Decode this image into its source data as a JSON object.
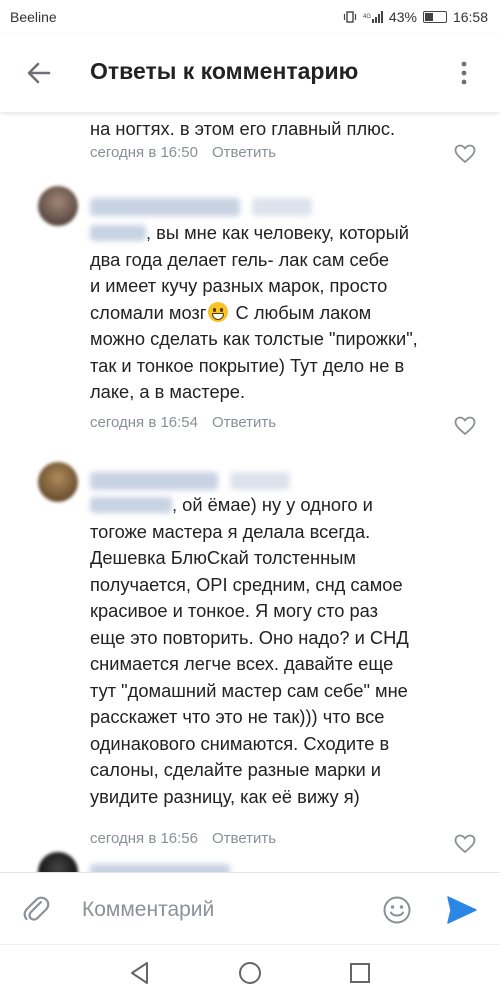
{
  "status_bar": {
    "carrier": "Beeline",
    "icons_text": "",
    "battery_percent": "43%",
    "battery_level": 0.43,
    "time": "16:58"
  },
  "header": {
    "title": "Ответы к комментарию",
    "back_icon": "arrow-left-icon",
    "menu_icon": "more-vertical-icon"
  },
  "comments": [
    {
      "lines": [
        "на ногтях. в этом его главный плюс."
      ],
      "time": "сегодня в 16:50",
      "reply_label": "Ответить"
    },
    {
      "lines_a": ", вы мне как человеку, который",
      "lines_b": [
        "два года делает гель- лак сам себе",
        "и имеет кучу разных марок, просто"
      ],
      "line_emoji_before": "сломали мозг",
      "line_emoji_after": " С любым лаком",
      "lines_c": [
        "можно сделать как толстые \"пирожки\",",
        "так и тонкое  покрытие) Тут дело не в",
        "лаке, а в мастере."
      ],
      "time": "сегодня в 16:54",
      "reply_label": "Ответить"
    },
    {
      "lines_a": ", ой ёмае) ну у одного и",
      "lines_b": [
        "тогоже мастера я делала всегда.",
        "Дешевка БлюСкай толстенным",
        "получается, OPI средним, снд самое",
        "красивое и тонкое. Я могу сто раз",
        "еще это повторить. Оно надо? и СНД",
        "снимается легче всех. давайте еще",
        "тут \"домашний мастер сам себе\" мне",
        "расскажет что это не так))) что все",
        "одинакового снимаются. Сходите в",
        "салоны, сделайте разные марки и",
        "увидите разницу, как её вижу я)"
      ],
      "time": "сегодня в 16:56",
      "reply_label": "Ответить"
    }
  ],
  "composer": {
    "placeholder": "Комментарий",
    "accent": "#2a87e6"
  }
}
